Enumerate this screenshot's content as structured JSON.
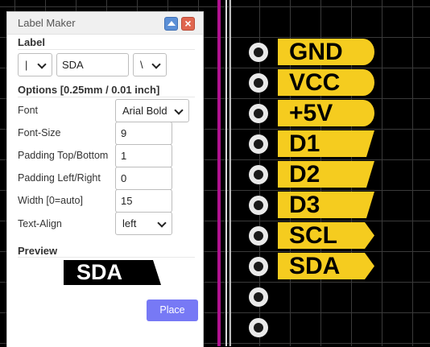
{
  "dialog": {
    "title": "Label Maker",
    "label_section": "Label",
    "left_shape": "|",
    "text_value": "SDA",
    "right_shape": "\\",
    "options_section": "Options [0.25mm / 0.01 inch]",
    "fields": [
      {
        "label": "Font",
        "value": "Arial Bold"
      },
      {
        "label": "Font-Size",
        "value": "9"
      },
      {
        "label": "Padding Top/Bottom",
        "value": "1"
      },
      {
        "label": "Padding Left/Right",
        "value": "0"
      },
      {
        "label": "Width [0=auto]",
        "value": "15"
      },
      {
        "label": "Text-Align",
        "value": "left"
      }
    ],
    "preview_section": "Preview",
    "preview_text": "SDA",
    "place_label": "Place",
    "close_glyph": "×"
  },
  "pins": [
    {
      "label": "GND",
      "shape": "rounded"
    },
    {
      "label": "VCC",
      "shape": "rounded"
    },
    {
      "label": "+5V",
      "shape": "rounded"
    },
    {
      "label": "D1",
      "shape": "slant"
    },
    {
      "label": "D2",
      "shape": "slant"
    },
    {
      "label": "D3",
      "shape": "slant"
    },
    {
      "label": "SCL",
      "shape": "arrow"
    },
    {
      "label": "SDA",
      "shape": "arrow"
    }
  ],
  "pad_count": 10,
  "colors": {
    "label_fill": "#f5cc1f",
    "magenta_line": "#b0128f",
    "place_button": "#7779f5"
  }
}
